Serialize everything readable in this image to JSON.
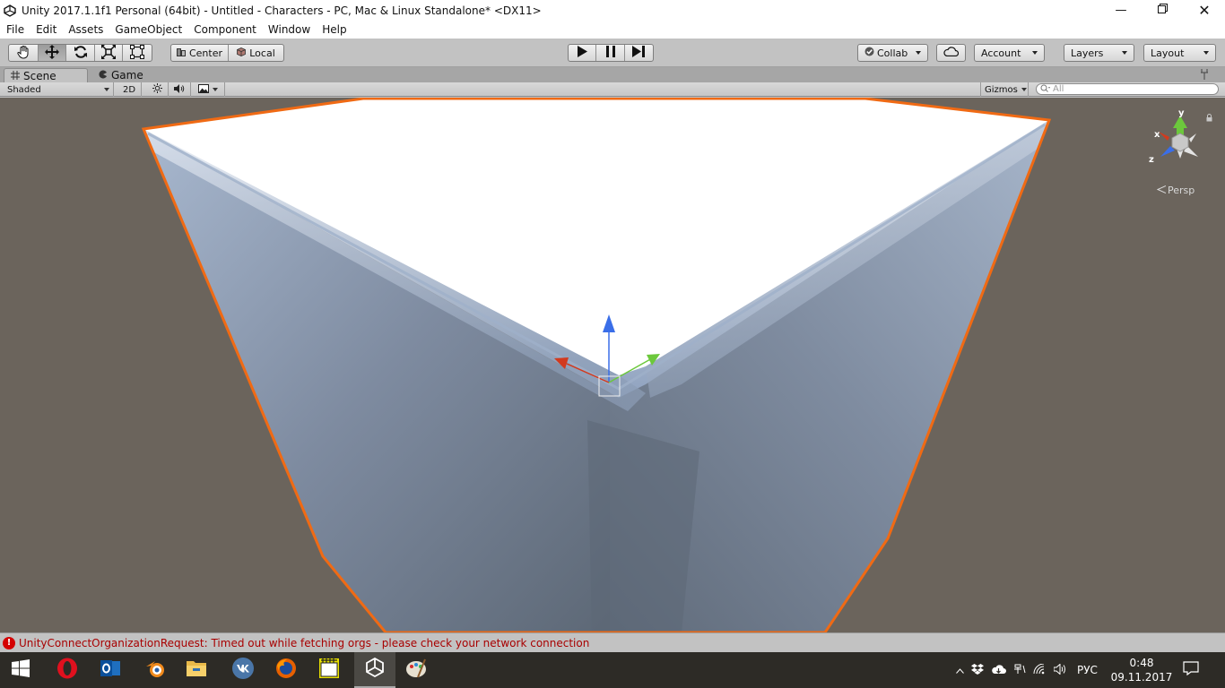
{
  "window": {
    "title": "Unity 2017.1.1f1 Personal (64bit) - Untitled - Characters - PC, Mac & Linux Standalone* <DX11>"
  },
  "menu": [
    "File",
    "Edit",
    "Assets",
    "GameObject",
    "Component",
    "Window",
    "Help"
  ],
  "toolbar": {
    "transform_tools": [
      "hand-icon",
      "move-icon",
      "rotate-icon",
      "scale-icon",
      "rect-icon"
    ],
    "active_tool": "move",
    "pivot_center": "Center",
    "pivot_local": "Local",
    "play_controls": [
      "play-icon",
      "pause-icon",
      "step-icon"
    ],
    "collab": "Collab",
    "account": "Account",
    "layers": "Layers",
    "layout": "Layout"
  },
  "tabs": {
    "scene": "Scene",
    "game": "Game",
    "active": "Scene"
  },
  "scene_bar": {
    "shading": "Shaded",
    "mode_2d": "2D",
    "gizmos": "Gizmos",
    "search_placeholder": "All"
  },
  "scene_gizmo": {
    "y": "y",
    "x": "x",
    "z": "z",
    "projection": "Persp"
  },
  "status": {
    "message": "UnityConnectOrganizationRequest: Timed out while fetching orgs - please check your network connection"
  },
  "taskbar": {
    "apps": [
      "windows-start-icon",
      "opera-icon",
      "outlook-icon",
      "blender-icon",
      "file-explorer-icon",
      "vk-icon",
      "firefox-icon",
      "media-player-icon",
      "unity-icon",
      "paint-icon"
    ],
    "active_app": "unity-icon",
    "language": "РУС",
    "time": "0:48",
    "date": "09.11.2017"
  },
  "colors": {
    "selection_outline": "#f06a14",
    "scene_background": "#6b645c",
    "error": "#d40000",
    "axis_x": "#d23a1e",
    "axis_y": "#6cc83c",
    "axis_z": "#3a6ee8"
  }
}
